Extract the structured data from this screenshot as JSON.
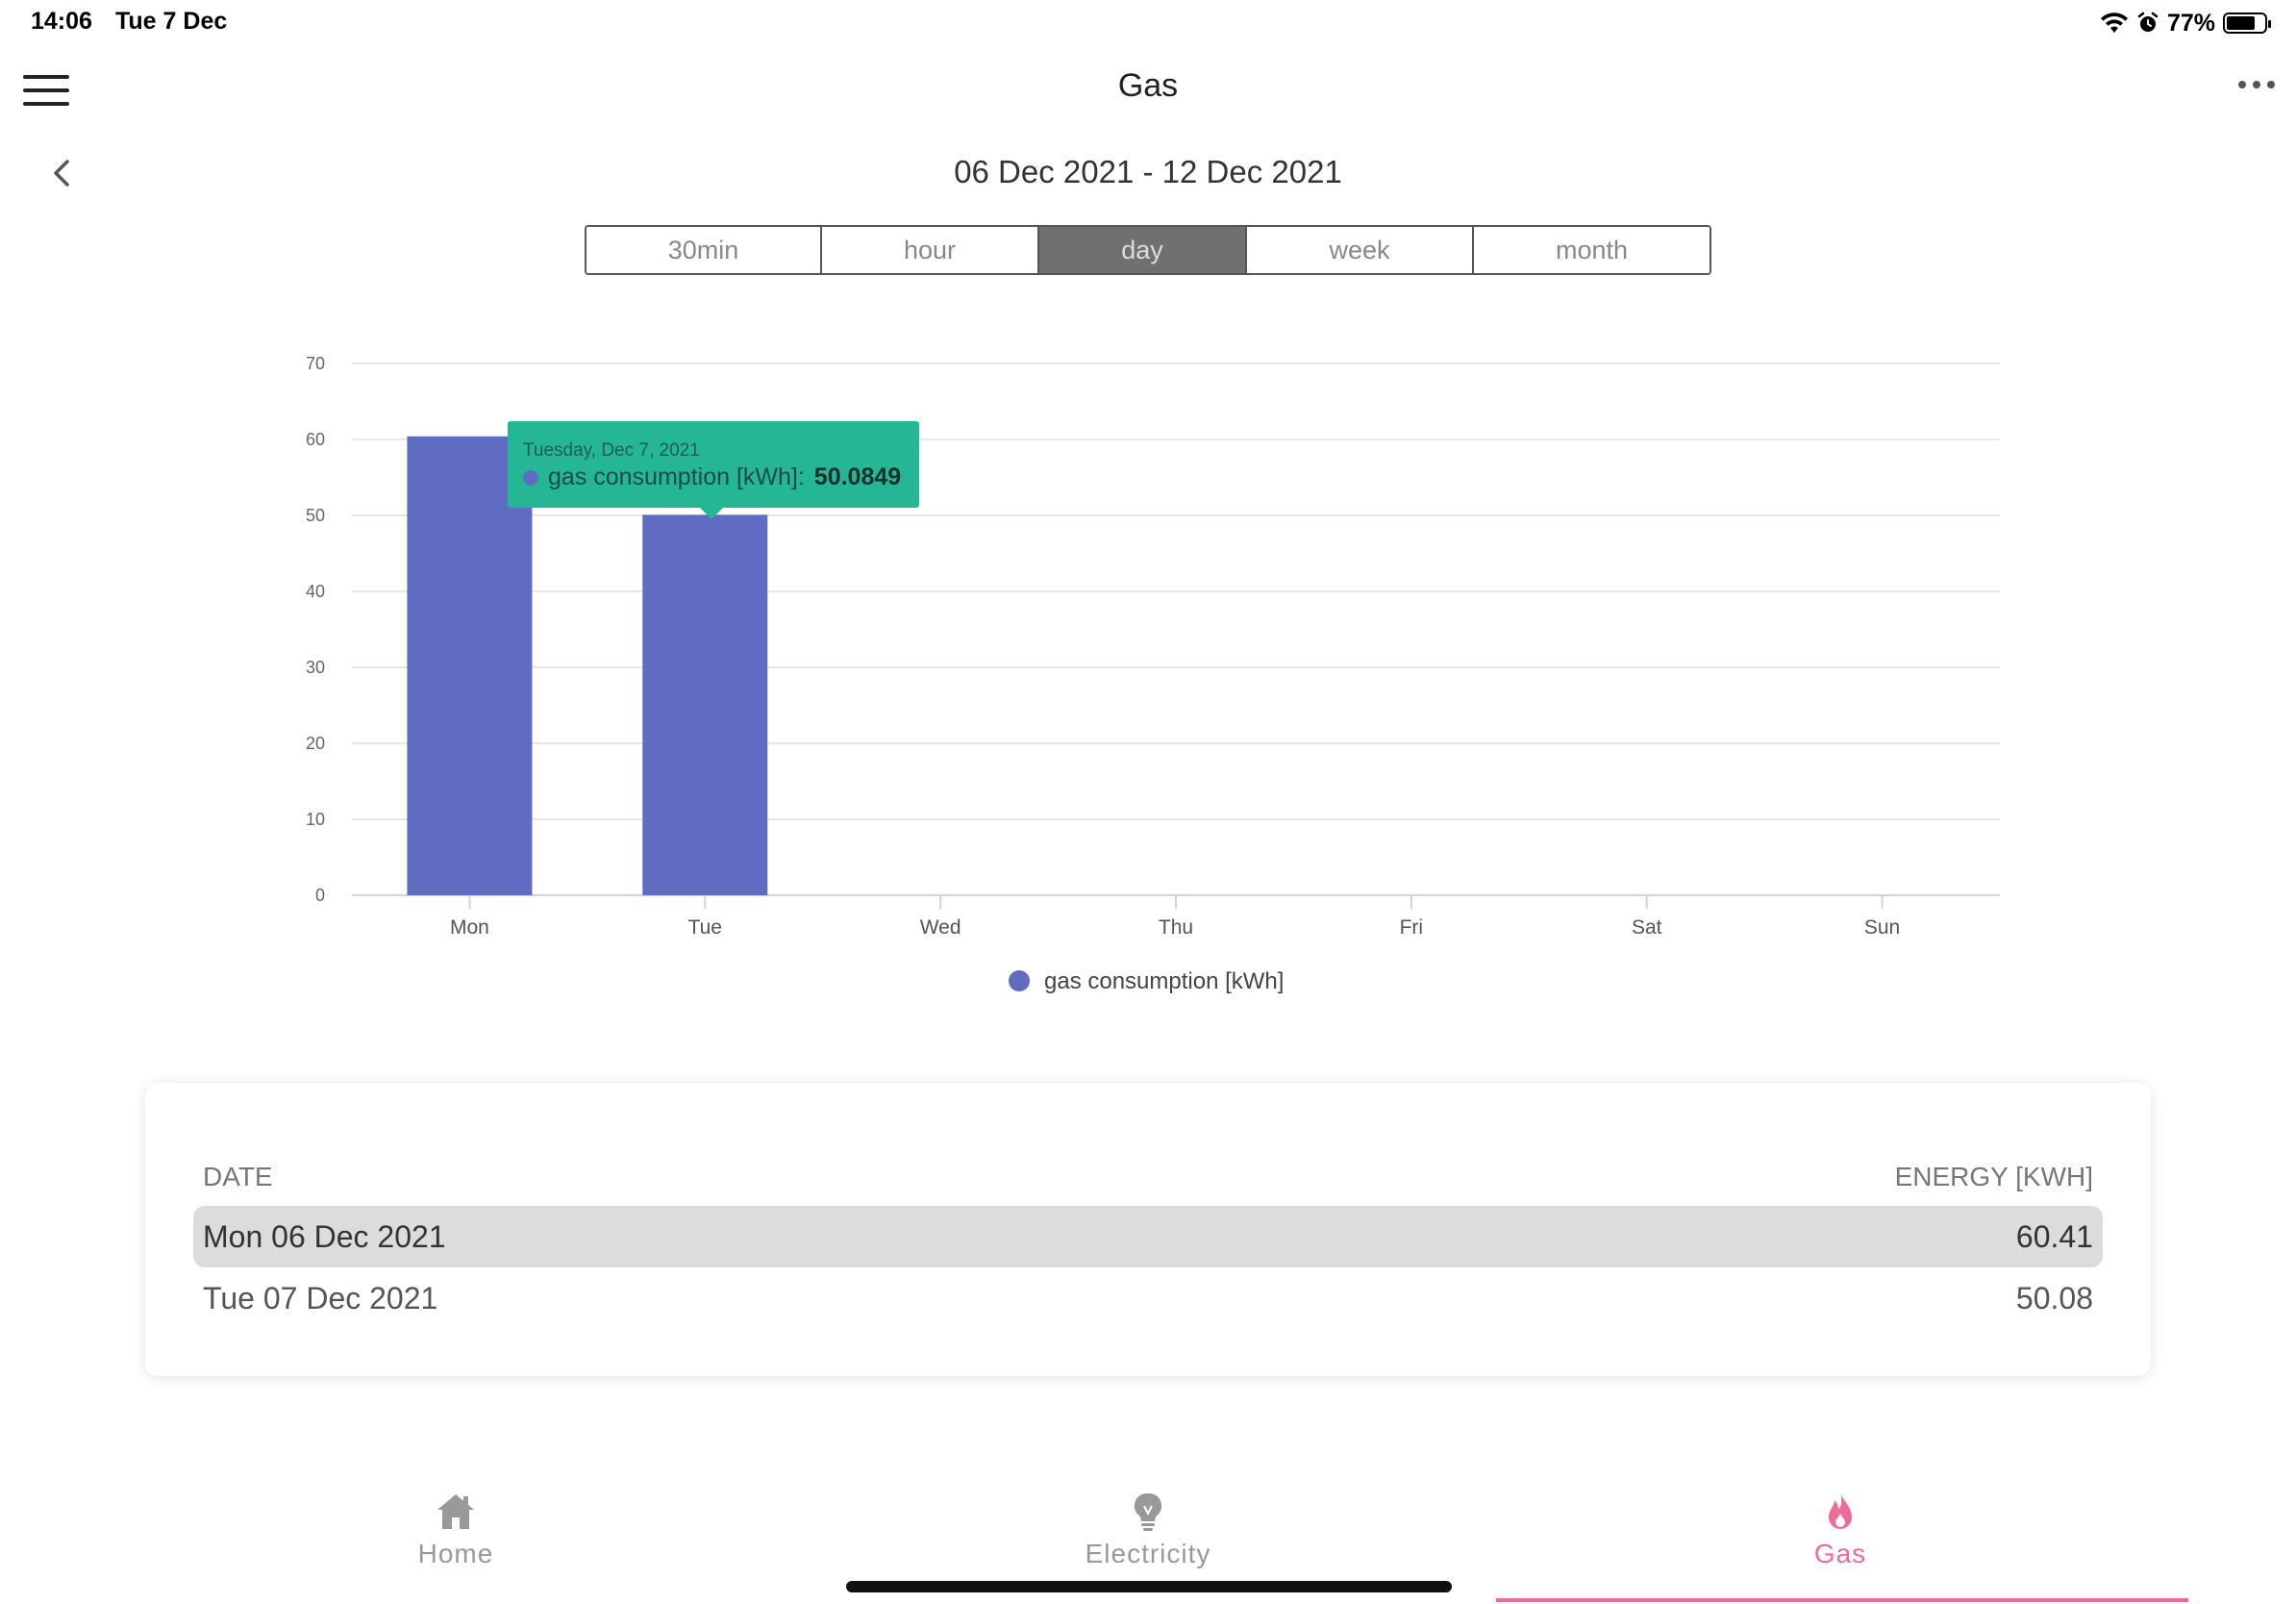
{
  "status_bar": {
    "time": "14:06",
    "date": "Tue 7 Dec",
    "battery": "77%"
  },
  "header": {
    "title": "Gas"
  },
  "date_range": "06 Dec 2021 - 12 Dec 2021",
  "segments": [
    {
      "label": "30min",
      "active": false
    },
    {
      "label": "hour",
      "active": false
    },
    {
      "label": "day",
      "active": true
    },
    {
      "label": "week",
      "active": false
    },
    {
      "label": "month",
      "active": false
    }
  ],
  "tooltip": {
    "date": "Tuesday, Dec 7, 2021",
    "series": "gas consumption [kWh]:",
    "value": "50.0849"
  },
  "chart_data": {
    "type": "bar",
    "categories": [
      "Mon",
      "Tue",
      "Wed",
      "Thu",
      "Fri",
      "Sat",
      "Sun"
    ],
    "series": [
      {
        "name": "gas consumption [kWh]",
        "values": [
          60.41,
          50.08,
          null,
          null,
          null,
          null,
          null
        ],
        "color": "#5f6cc1"
      }
    ],
    "ylim": [
      0,
      70
    ],
    "yticks": [
      0,
      10,
      20,
      30,
      40,
      50,
      60,
      70
    ],
    "grid": true,
    "legend": "bottom-center"
  },
  "table": {
    "headers": {
      "date": "DATE",
      "energy": "ENERGY [KWH]"
    },
    "rows": [
      {
        "date": "Mon 06 Dec 2021",
        "energy": "60.41",
        "selected": true
      },
      {
        "date": "Tue 07 Dec 2021",
        "energy": "50.08",
        "selected": false
      }
    ]
  },
  "tabs": [
    {
      "label": "Home",
      "icon": "home-icon",
      "active": false
    },
    {
      "label": "Electricity",
      "icon": "lightbulb-icon",
      "active": false
    },
    {
      "label": "Gas",
      "icon": "flame-icon",
      "active": true
    }
  ],
  "colors": {
    "accent": "#ef6a96",
    "bar": "#5f6cc1",
    "tooltip": "#25b795",
    "active_segment": "#707070"
  }
}
